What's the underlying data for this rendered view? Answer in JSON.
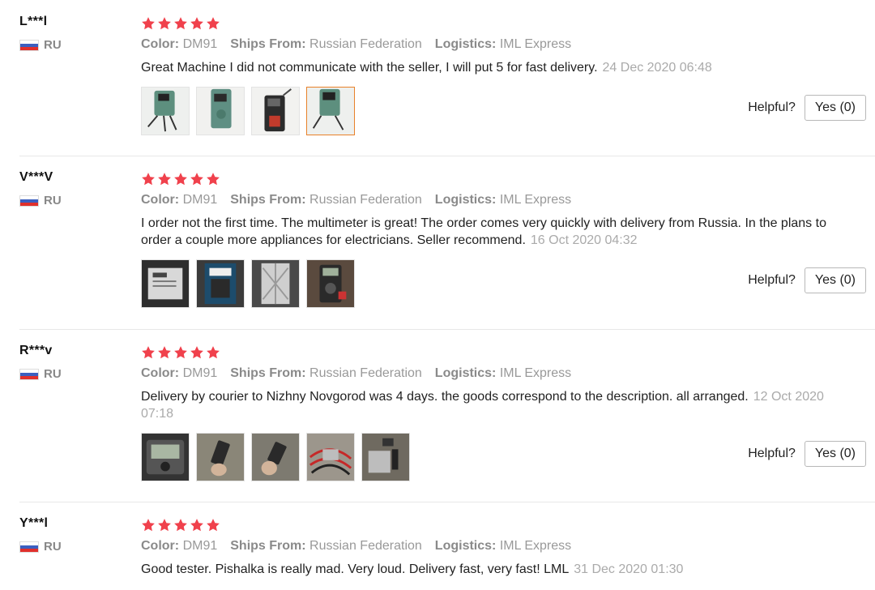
{
  "accent_star_color": "#f0414c",
  "reviews": [
    {
      "user": "L***l",
      "country": "RU",
      "color_label": "Color:",
      "color": "DM91",
      "ships_label": "Ships From:",
      "ships": "Russian Federation",
      "logistics_label": "Logistics:",
      "logistics": "IML Express",
      "text": "Great Machine I did not communicate with the seller, I will put 5 for fast delivery.",
      "date": "24 Dec 2020 06:48",
      "rating": 5,
      "photo_count": 4,
      "helpful_label": "Helpful?",
      "yes_label": "Yes (0)"
    },
    {
      "user": "V***V",
      "country": "RU",
      "color_label": "Color:",
      "color": "DM91",
      "ships_label": "Ships From:",
      "ships": "Russian Federation",
      "logistics_label": "Logistics:",
      "logistics": "IML Express",
      "text": "I order not the first time. The multimeter is great! The order comes very quickly with delivery from Russia. In the plans to order a couple more appliances for electricians. Seller recommend.",
      "date": "16 Oct 2020 04:32",
      "rating": 5,
      "photo_count": 4,
      "helpful_label": "Helpful?",
      "yes_label": "Yes (0)"
    },
    {
      "user": "R***v",
      "country": "RU",
      "color_label": "Color:",
      "color": "DM91",
      "ships_label": "Ships From:",
      "ships": "Russian Federation",
      "logistics_label": "Logistics:",
      "logistics": "IML Express",
      "text": "Delivery by courier to Nizhny Novgorod was 4 days. the goods correspond to the description. all arranged.",
      "date": "12 Oct 2020 07:18",
      "rating": 5,
      "photo_count": 5,
      "helpful_label": "Helpful?",
      "yes_label": "Yes (0)"
    },
    {
      "user": "Y***l",
      "country": "RU",
      "color_label": "Color:",
      "color": "DM91",
      "ships_label": "Ships From:",
      "ships": "Russian Federation",
      "logistics_label": "Logistics:",
      "logistics": "IML Express",
      "text": "Good tester. Pishalka is really mad. Very loud. Delivery fast, very fast! LML",
      "date": "31 Dec 2020 01:30",
      "rating": 5
    }
  ]
}
